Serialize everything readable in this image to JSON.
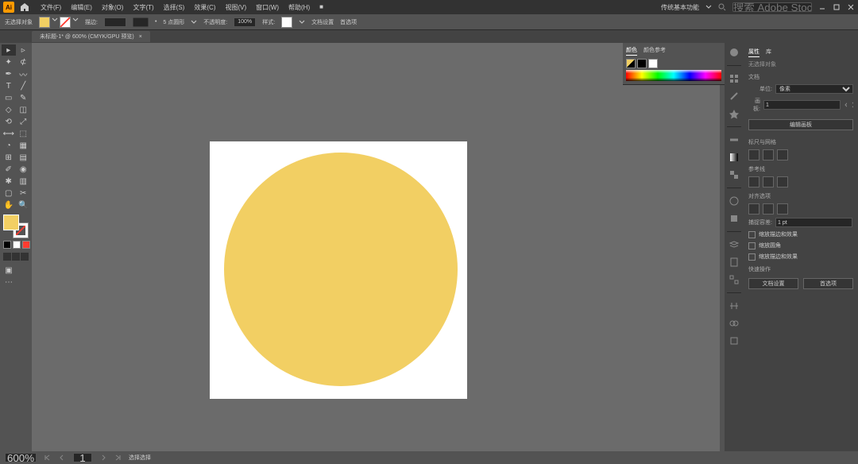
{
  "app_logo": "Ai",
  "menus": [
    "文件(F)",
    "编辑(E)",
    "对象(O)",
    "文字(T)",
    "选择(S)",
    "效果(C)",
    "视图(V)",
    "窗口(W)",
    "帮助(H)",
    "■"
  ],
  "workspace_label": "传统基本功能",
  "search_placeholder": "搜索 Adobe Stock",
  "options": {
    "label_left": "无选择对象",
    "stroke_label": "描边:",
    "stroke_value": "",
    "brush_label": "5 点圆形",
    "opacity_label": "不透明度:",
    "opacity_value": "100%",
    "style_label": "样式:",
    "doc_setup": "文档设置",
    "prefs": "首选项"
  },
  "document": {
    "tab_title": "未标题-1* @ 600% (CMYK/GPU 预览)"
  },
  "color_panel": {
    "tab1": "颜色",
    "tab2": "颜色参考"
  },
  "props": {
    "title": "属性",
    "tab2": "库",
    "heading": "无选择对象",
    "section_doc": "文档",
    "unit_label": "单位:",
    "unit_value": "像素",
    "artboard_label": "画板:",
    "artboard_value": "1",
    "edit_artboards": "编辑画板",
    "section_align": "标尺与网格",
    "section_guides": "参考线",
    "section_snap": "对齐选项",
    "snap_value_label": "捕捉容差:",
    "snap_value": "1 pt",
    "cb1": "缩放描边和效果",
    "cb2": "缩放圆角",
    "cb3": "缩放描边和效果",
    "section_quick": "快速操作",
    "btn1": "文档设置",
    "btn2": "首选项"
  },
  "status": {
    "zoom": "600%",
    "nav_value": "1",
    "mode": "选择选择"
  },
  "canvas": {
    "fill_color": "#f2cf63"
  }
}
